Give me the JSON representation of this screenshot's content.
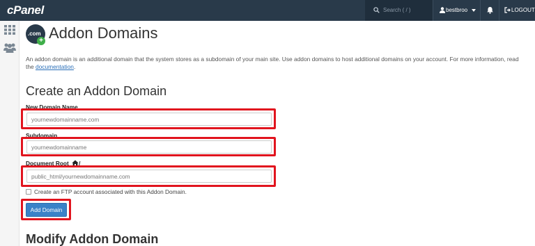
{
  "topbar": {
    "logo": "cPanel",
    "search_placeholder": "Search ( / )",
    "username": "bestbroo",
    "logout_label": "LOGOUT"
  },
  "page": {
    "icon_text": ".com",
    "icon_badge": "+",
    "title": "Addon Domains",
    "description": "An addon domain is an additional domain that the system stores as a subdomain of your main site. Use addon domains to host additional domains on your account. For more information, read the",
    "doc_link": "documentation",
    "doc_suffix": "."
  },
  "create_section": {
    "title": "Create an Addon Domain",
    "new_domain_label": "New Domain Name",
    "new_domain_placeholder": "yournewdomainname.com",
    "subdomain_label": "Subdomain",
    "subdomain_placeholder": "yournewdomainname",
    "doc_root_label": "Document Root",
    "doc_root_suffix": "/",
    "doc_root_placeholder": "public_html/yournewdomainname.com",
    "ftp_checkbox_label": "Create an FTP account associated with this Addon Domain.",
    "ftp_checked": false,
    "add_button_label": "Add Domain"
  },
  "modify_section": {
    "title": "Modify Addon Domain"
  },
  "colors": {
    "topbar": "#293a4a",
    "accent_button": "#3a82c8",
    "highlight": "#e1141e",
    "link": "#2a6fb8"
  }
}
